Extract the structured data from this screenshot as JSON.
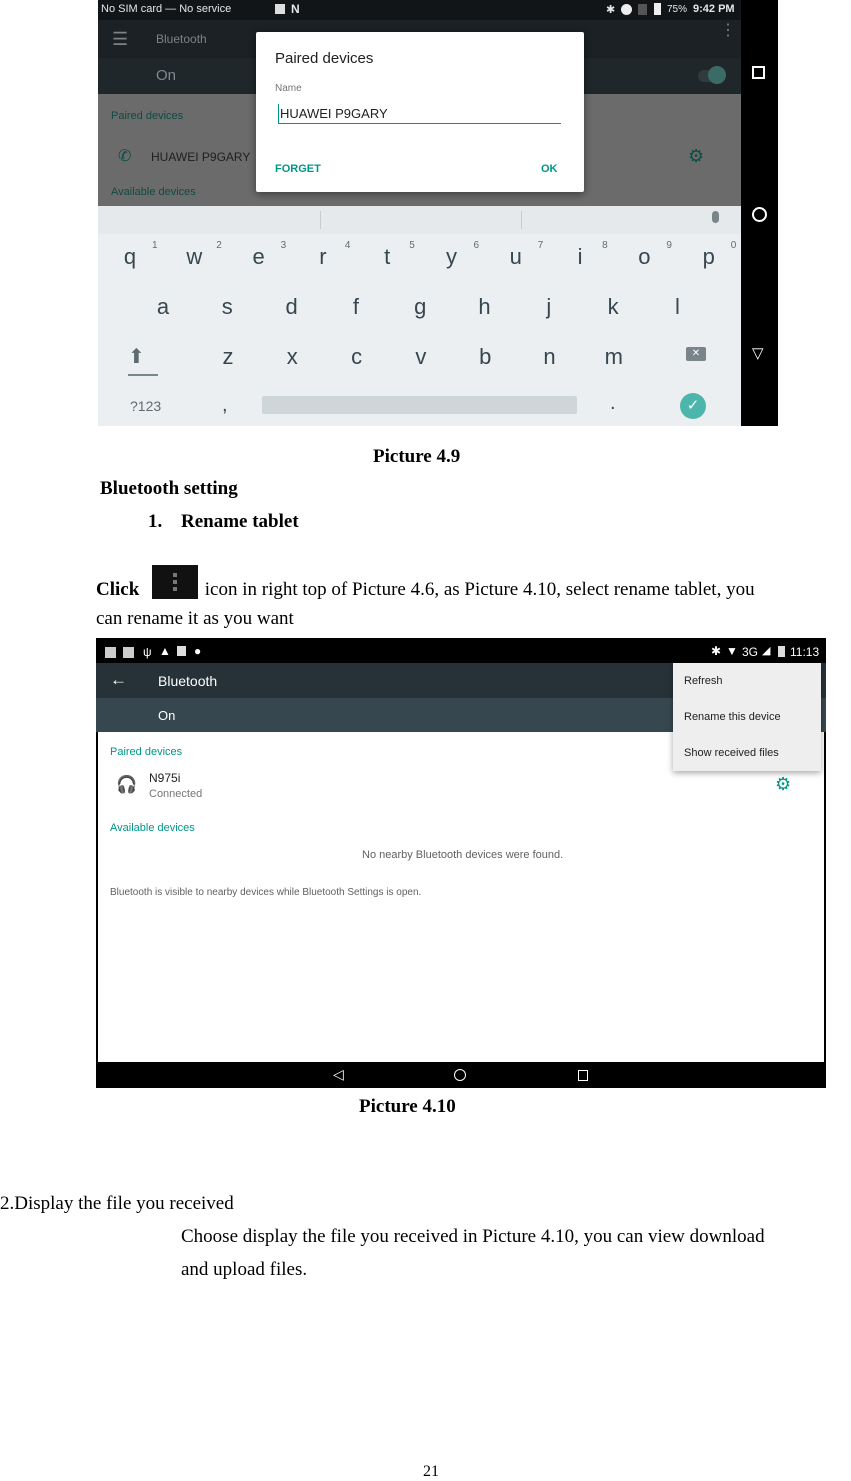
{
  "picture_4_9": {
    "status_bar": {
      "left_text": "No SIM card — No service",
      "battery": "75%",
      "time": "9:42 PM",
      "icons": [
        "image-icon",
        "n-icon",
        "bluetooth-icon",
        "do-not-disturb-icon",
        "no-sim-icon",
        "battery-charging-icon"
      ]
    },
    "app_bar": {
      "title": "Bluetooth"
    },
    "toggle_row": {
      "label": "On",
      "state": true
    },
    "paired_header": "Paired devices",
    "paired_device": {
      "name": "HUAWEI P9GARY"
    },
    "available_header": "Available devices",
    "dialog": {
      "title": "Paired devices",
      "field_label": "Name",
      "field_value": "HUAWEI P9GARY",
      "forget_label": "FORGET",
      "ok_label": "OK"
    },
    "keyboard": {
      "row1": [
        [
          "q",
          "1"
        ],
        [
          "w",
          "2"
        ],
        [
          "e",
          "3"
        ],
        [
          "r",
          "4"
        ],
        [
          "t",
          "5"
        ],
        [
          "y",
          "6"
        ],
        [
          "u",
          "7"
        ],
        [
          "i",
          "8"
        ],
        [
          "o",
          "9"
        ],
        [
          "p",
          "0"
        ]
      ],
      "row2": [
        "a",
        "s",
        "d",
        "f",
        "g",
        "h",
        "j",
        "k",
        "l"
      ],
      "row3": [
        "z",
        "x",
        "c",
        "v",
        "b",
        "n",
        "m"
      ],
      "symbols_label": "?123",
      "comma": ",",
      "period": "."
    },
    "caption": "Picture 4.9"
  },
  "section_heading": "Bluetooth setting",
  "item1": {
    "number": "1.",
    "title": "Rename tablet"
  },
  "para1": {
    "click": "Click",
    "text_line1": " icon in right top of Picture 4.6, as Picture 4.10, select rename tablet, you",
    "text_line2": "can rename it as you want"
  },
  "picture_4_10": {
    "status_bar": {
      "network": "3G",
      "time": "11:13"
    },
    "app_bar": {
      "title": "Bluetooth"
    },
    "toggle_row": {
      "label": "On"
    },
    "paired_header": "Paired devices",
    "paired_device": {
      "name": "N975i",
      "status": "Connected"
    },
    "available_header": "Available devices",
    "empty_message": "No nearby Bluetooth devices were found.",
    "visibility_note": "Bluetooth is visible to nearby devices while Bluetooth Settings is open.",
    "menu": [
      "Refresh",
      "Rename this device",
      "Show received files"
    ],
    "caption": "Picture 4.10"
  },
  "item2": {
    "title": "2.Display the file you received",
    "body_line1": "Choose display the file you received in Picture 4.10, you can view download",
    "body_line2": "and upload files."
  },
  "page_number": "21",
  "colors": {
    "accent": "#009688",
    "appbar_dark": "#263238",
    "keyboard_bg": "#eceff1"
  }
}
